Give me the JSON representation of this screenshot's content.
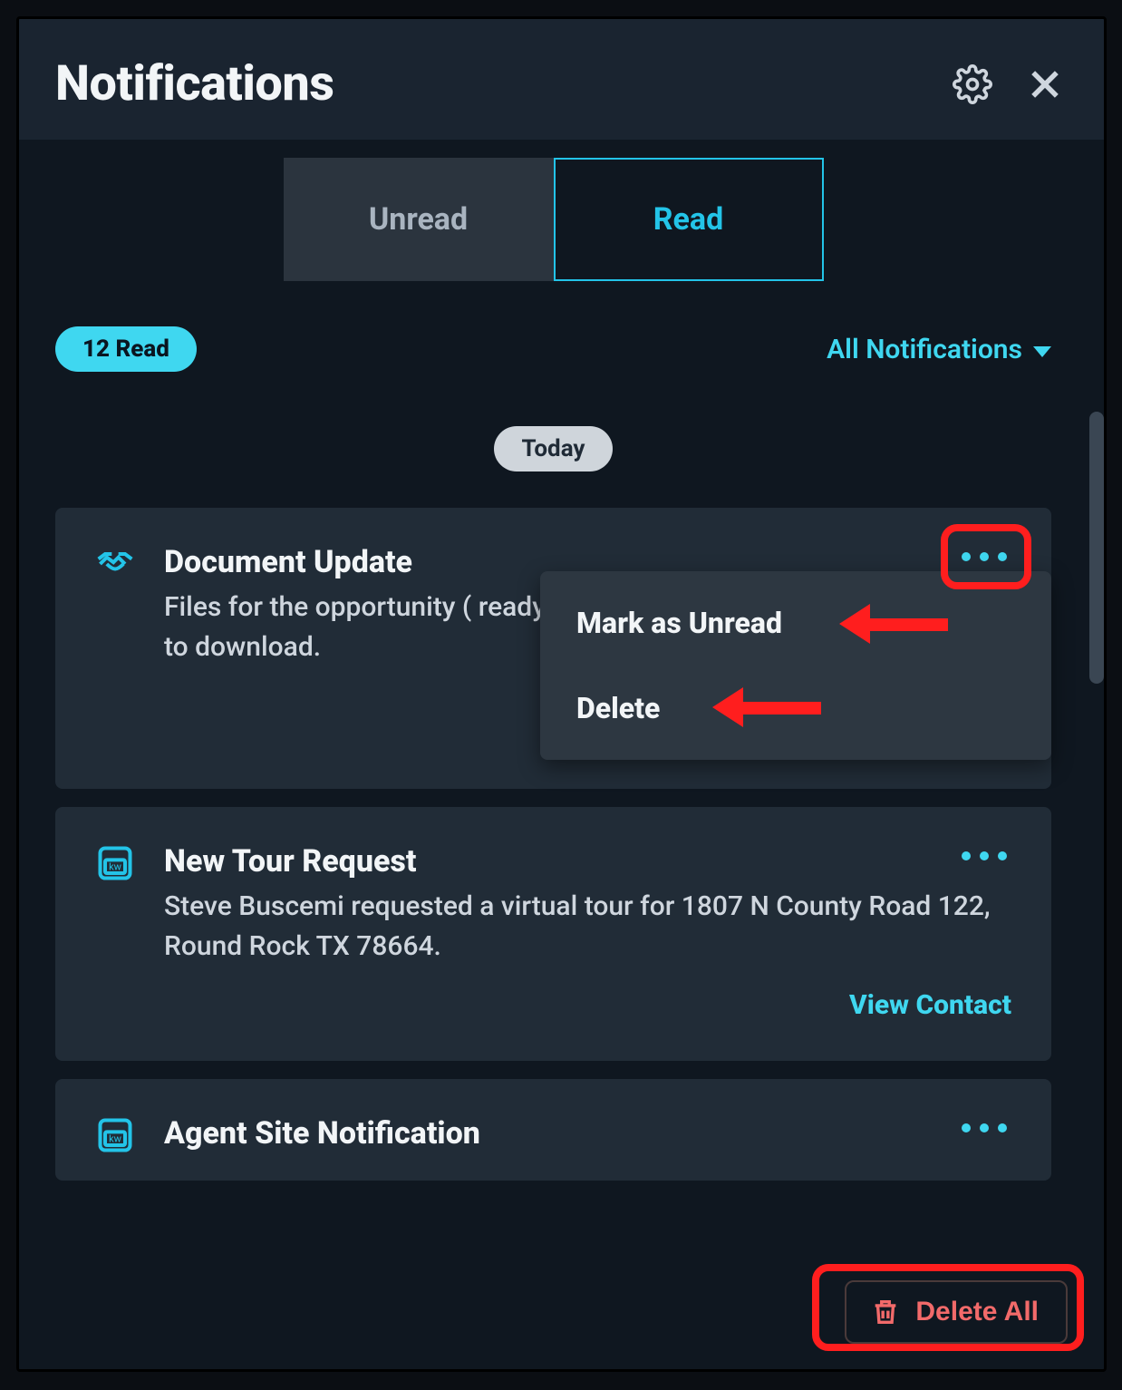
{
  "header": {
    "title": "Notifications"
  },
  "tabs": {
    "unread": "Unread",
    "read": "Read",
    "active": "read"
  },
  "filter": {
    "count_label": "12 Read",
    "dropdown_label": "All Notifications"
  },
  "groups": [
    {
      "label": "Today"
    }
  ],
  "cards": [
    {
      "icon": "handshake",
      "title": "Document Update",
      "body": "Files for the opportunity (              ready to download.",
      "menu_open": true,
      "menu": {
        "mark_unread": "Mark as Unread",
        "delete": "Delete"
      }
    },
    {
      "icon": "kw-badge",
      "title": "New Tour Request",
      "body": "Steve Buscemi requested a virtual tour for 1807 N County Road 122, Round Rock TX 78664.",
      "action": "View Contact"
    },
    {
      "icon": "kw-badge",
      "title": "Agent Site Notification",
      "body": ""
    }
  ],
  "footer": {
    "delete_all": "Delete All"
  }
}
